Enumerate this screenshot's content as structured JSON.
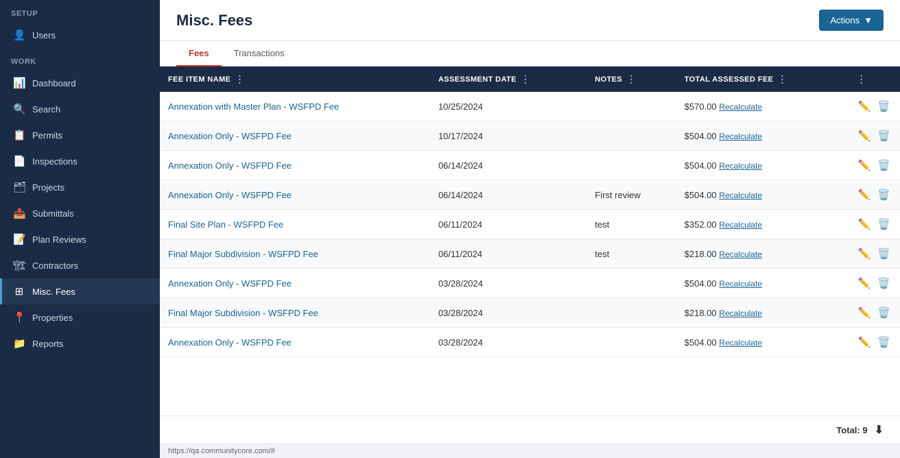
{
  "sidebar": {
    "setup_label": "SETUP",
    "work_label": "WORK",
    "items": [
      {
        "id": "users",
        "label": "Users",
        "icon": "👤",
        "active": false
      },
      {
        "id": "dashboard",
        "label": "Dashboard",
        "icon": "📊",
        "active": false
      },
      {
        "id": "search",
        "label": "Search",
        "icon": "🔍",
        "active": false
      },
      {
        "id": "permits",
        "label": "Permits",
        "icon": "📋",
        "active": false
      },
      {
        "id": "inspections",
        "label": "Inspections",
        "icon": "📄",
        "active": false
      },
      {
        "id": "projects",
        "label": "Projects",
        "icon": "🗂",
        "active": false
      },
      {
        "id": "submittals",
        "label": "Submittals",
        "icon": "📤",
        "active": false
      },
      {
        "id": "plan-reviews",
        "label": "Plan Reviews",
        "icon": "📝",
        "active": false
      },
      {
        "id": "contractors",
        "label": "Contractors",
        "icon": "🏗",
        "active": false
      },
      {
        "id": "misc-fees",
        "label": "Misc. Fees",
        "icon": "⊞",
        "active": true
      },
      {
        "id": "properties",
        "label": "Properties",
        "icon": "📍",
        "active": false
      },
      {
        "id": "reports",
        "label": "Reports",
        "icon": "📁",
        "active": false
      }
    ]
  },
  "header": {
    "title": "Misc. Fees",
    "actions_label": "Actions",
    "actions_arrow": "▼"
  },
  "tabs": [
    {
      "id": "fees",
      "label": "Fees",
      "active": true
    },
    {
      "id": "transactions",
      "label": "Transactions",
      "active": false
    }
  ],
  "table": {
    "columns": [
      {
        "id": "fee-item-name",
        "label": "FEE ITEM NAME"
      },
      {
        "id": "assessment-date",
        "label": "ASSESSMENT DATE"
      },
      {
        "id": "notes",
        "label": "NOTES"
      },
      {
        "id": "total-assessed-fee",
        "label": "TOTAL ASSESSED FEE"
      },
      {
        "id": "actions",
        "label": ""
      }
    ],
    "rows": [
      {
        "id": 1,
        "name": "Annexation with Master Plan - WSFPD Fee",
        "assessment_date": "10/25/2024",
        "notes": "",
        "amount": "$570.00"
      },
      {
        "id": 2,
        "name": "Annexation Only - WSFPD Fee",
        "assessment_date": "10/17/2024",
        "notes": "",
        "amount": "$504.00"
      },
      {
        "id": 3,
        "name": "Annexation Only - WSFPD Fee",
        "assessment_date": "06/14/2024",
        "notes": "",
        "amount": "$504.00"
      },
      {
        "id": 4,
        "name": "Annexation Only - WSFPD Fee",
        "assessment_date": "06/14/2024",
        "notes": "First review",
        "amount": "$504.00"
      },
      {
        "id": 5,
        "name": "Final Site Plan - WSFPD Fee",
        "assessment_date": "06/11/2024",
        "notes": "test",
        "amount": "$352.00"
      },
      {
        "id": 6,
        "name": "Final Major Subdivision - WSFPD Fee",
        "assessment_date": "06/11/2024",
        "notes": "test",
        "amount": "$218.00"
      },
      {
        "id": 7,
        "name": "Annexation Only - WSFPD Fee",
        "assessment_date": "03/28/2024",
        "notes": "",
        "amount": "$504.00"
      },
      {
        "id": 8,
        "name": "Final Major Subdivision - WSFPD Fee",
        "assessment_date": "03/28/2024",
        "notes": "",
        "amount": "$218.00"
      },
      {
        "id": 9,
        "name": "Annexation Only - WSFPD Fee",
        "assessment_date": "03/28/2024",
        "notes": "",
        "amount": "$504.00"
      }
    ],
    "recalculate_label": "Recalculate"
  },
  "footer": {
    "total_label": "Total: 9",
    "download_icon": "⬇"
  },
  "status_bar": {
    "url": "https://qa.communitycore.com/#"
  }
}
